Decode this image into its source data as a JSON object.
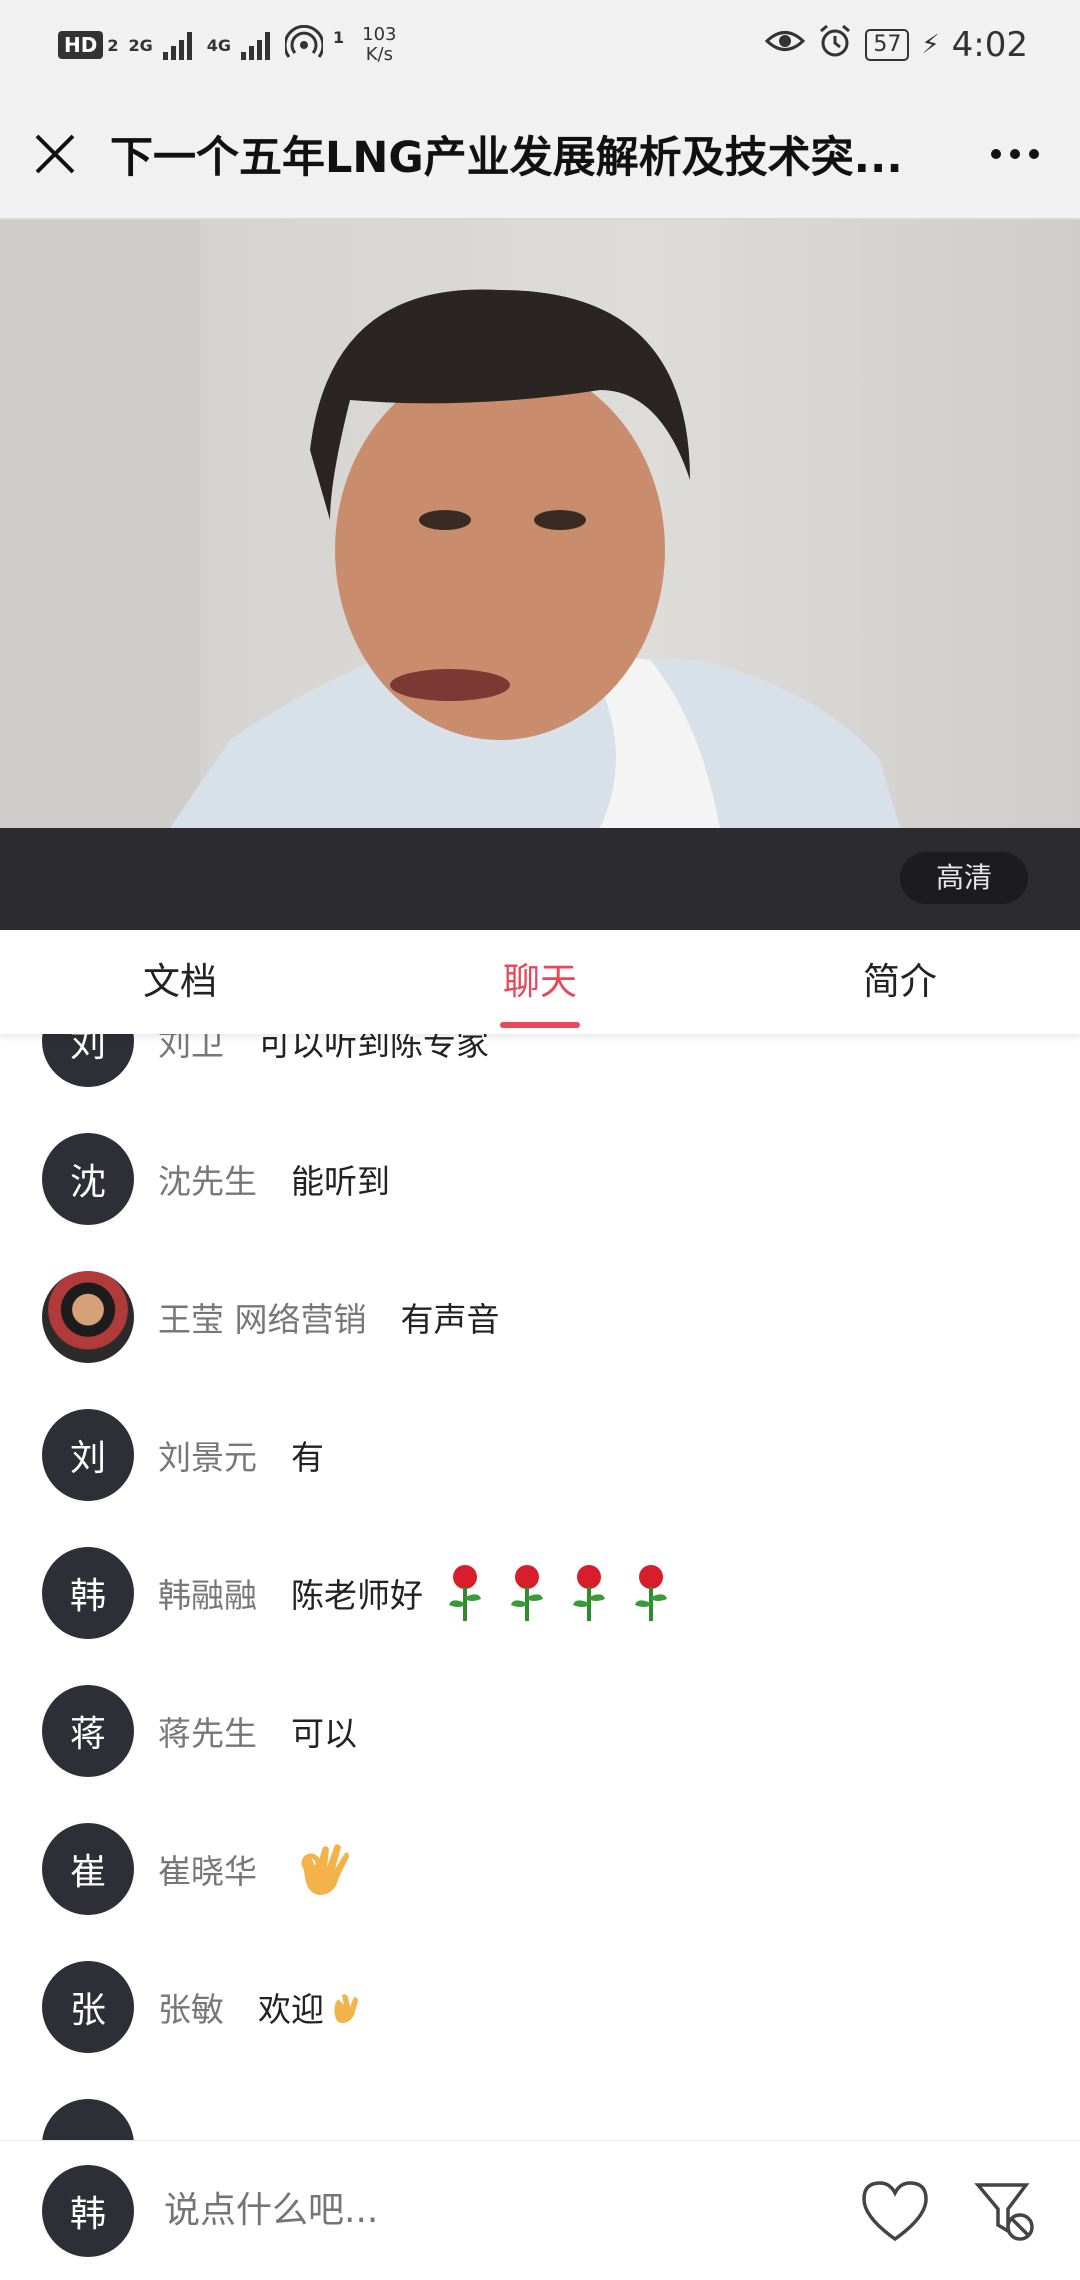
{
  "status_bar": {
    "hd_label": "HD",
    "sim": "2",
    "net_2g": "2G",
    "net_4g": "4G",
    "hotspot_count": "1",
    "speed_value": "103",
    "speed_unit": "K/s",
    "battery": "57",
    "time": "4:02"
  },
  "header": {
    "title": "下一个五年LNG产业发展解析及技术突...",
    "more": "···"
  },
  "video": {
    "quality_label": "高清"
  },
  "tabs": [
    {
      "label": "文档"
    },
    {
      "label": "聊天"
    },
    {
      "label": "简介"
    }
  ],
  "active_tab": "聊天",
  "chat": [
    {
      "avatar": "刘",
      "name": "刘卫",
      "text": "可以听到陈专家"
    },
    {
      "avatar": "沈",
      "name": "沈先生",
      "text": "能听到"
    },
    {
      "avatar": "",
      "name": "王莹 网络营销",
      "text": "有声音"
    },
    {
      "avatar": "刘",
      "name": "刘景元",
      "text": "有"
    },
    {
      "avatar": "韩",
      "name": "韩融融",
      "text": "陈老师好"
    },
    {
      "avatar": "蒋",
      "name": "蒋先生",
      "text": "可以"
    },
    {
      "avatar": "崔",
      "name": "崔晓华",
      "text": ""
    },
    {
      "avatar": "张",
      "name": "张敏",
      "text": "欢迎"
    }
  ],
  "input_bar": {
    "avatar": "韩",
    "placeholder": "说点什么吧..."
  },
  "icons": {
    "close": "close-icon",
    "more": "more-icon",
    "like": "heart-icon",
    "block": "filter-block-icon",
    "rose": "rose-emoji-icon",
    "ok": "ok-hand-emoji-icon",
    "clap": "clap-emoji-icon"
  },
  "colors": {
    "accent": "#e8485a",
    "avatar_bg": "#2e2e36",
    "control_bar": "#2b2b30"
  }
}
